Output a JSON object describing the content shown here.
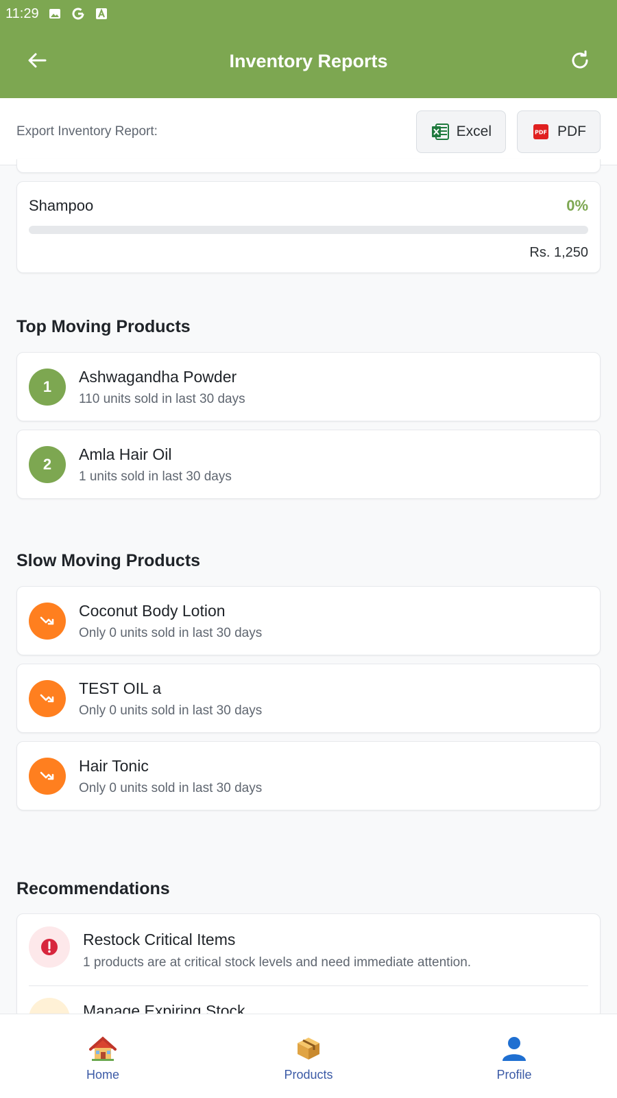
{
  "status_bar": {
    "time": "11:29"
  },
  "app_bar": {
    "title": "Inventory Reports"
  },
  "export": {
    "label": "Export Inventory Report:",
    "excel_label": "Excel",
    "pdf_label": "PDF"
  },
  "category_card": {
    "name": "Shampoo",
    "percent": "0%",
    "progress": 0,
    "value": "Rs. 1,250"
  },
  "top_moving": {
    "title": "Top Moving Products",
    "items": [
      {
        "rank": "1",
        "name": "Ashwagandha Powder",
        "sub": "110 units sold in last 30 days"
      },
      {
        "rank": "2",
        "name": "Amla Hair Oil",
        "sub": "1 units sold in last 30 days"
      }
    ]
  },
  "slow_moving": {
    "title": "Slow Moving Products",
    "items": [
      {
        "name": "Coconut Body Lotion",
        "sub": "Only 0 units sold in last 30 days"
      },
      {
        "name": "TEST OIL a",
        "sub": "Only 0 units sold in last 30 days"
      },
      {
        "name": "Hair Tonic",
        "sub": "Only 0 units sold in last 30 days"
      }
    ]
  },
  "recommendations": {
    "title": "Recommendations",
    "items": [
      {
        "title": "Restock Critical Items",
        "sub": "1 products are at critical stock levels and need immediate attention."
      },
      {
        "title": "Manage Expiring Stock"
      }
    ]
  },
  "bottom_nav": {
    "home": "Home",
    "products": "Products",
    "profile": "Profile"
  },
  "colors": {
    "primary": "#7da751",
    "slow": "#ff7f1f",
    "critical": "#e11d48",
    "nav": "#3b5aa6"
  }
}
